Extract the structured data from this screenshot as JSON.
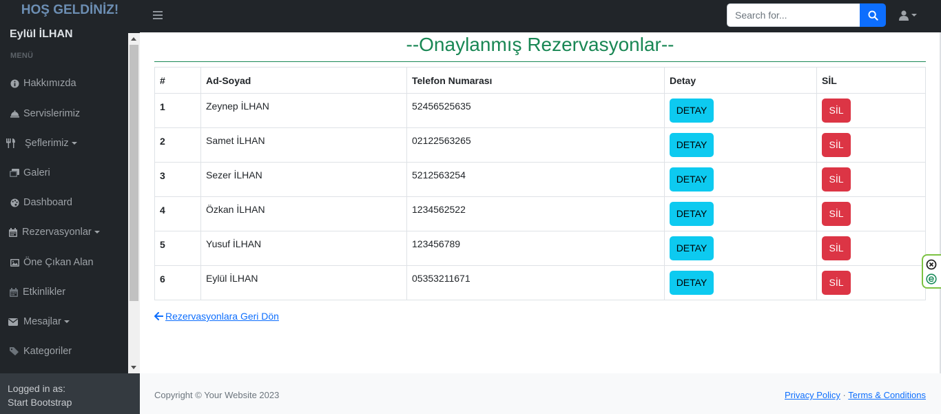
{
  "app": {
    "brand": "HOŞ GELDİNİZ!"
  },
  "topbar": {
    "search_placeholder": "Search for..."
  },
  "sidebar": {
    "user_name": "Eylül İLHAN",
    "heading": "MENÜ",
    "items": [
      {
        "label": "Hakkımızda",
        "icon": "info-circle-icon",
        "dropdown": false
      },
      {
        "label": "Servislerimiz",
        "icon": "bell-concierge-icon",
        "dropdown": false
      },
      {
        "label": "Şeflerimiz",
        "icon": "utensils-icon",
        "dropdown": true
      },
      {
        "label": "Galeri",
        "icon": "images-icon",
        "dropdown": false
      },
      {
        "label": "Dashboard",
        "icon": "palette-icon",
        "dropdown": false
      },
      {
        "label": "Rezervasyonlar",
        "icon": "calendar-icon",
        "dropdown": true
      },
      {
        "label": "Öne Çıkan Alan",
        "icon": "image-icon",
        "dropdown": false
      },
      {
        "label": "Etkinlikler",
        "icon": "calendar-icon",
        "dropdown": false
      },
      {
        "label": "Mesajlar",
        "icon": "envelope-icon",
        "dropdown": true
      },
      {
        "label": "Kategoriler",
        "icon": "tags-icon",
        "dropdown": false
      }
    ],
    "footer_line1": "Logged in as:",
    "footer_line2": "Start Bootstrap"
  },
  "main": {
    "title": "--Onaylanmış Rezervasyonlar--",
    "table": {
      "headers": [
        "#",
        "Ad-Soyad",
        "Telefon Numarası",
        "Detay",
        "SİL"
      ],
      "detail_button": "DETAY",
      "delete_button": "SİL",
      "rows": [
        {
          "no": "1",
          "name": "Zeynep İLHAN",
          "phone": "52456525635"
        },
        {
          "no": "2",
          "name": "Samet İLHAN",
          "phone": "02122563265"
        },
        {
          "no": "3",
          "name": "Sezer İLHAN",
          "phone": "5212563254"
        },
        {
          "no": "4",
          "name": "Özkan İLHAN",
          "phone": "1234562522"
        },
        {
          "no": "5",
          "name": "Yusuf İLHAN",
          "phone": "123456789"
        },
        {
          "no": "6",
          "name": "Eylül İLHAN",
          "phone": "05353211671"
        }
      ]
    },
    "back_link": "Rezervasyonlara Geri Dön"
  },
  "footer": {
    "copyright": "Copyright © Your Website 2023",
    "privacy": "Privacy Policy",
    "separator": "·",
    "terms": "Terms & Conditions"
  },
  "colors": {
    "title_green": "#198754",
    "detail_button": "#0dcaf0",
    "delete_button": "#dc3545",
    "primary": "#0d6efd"
  }
}
